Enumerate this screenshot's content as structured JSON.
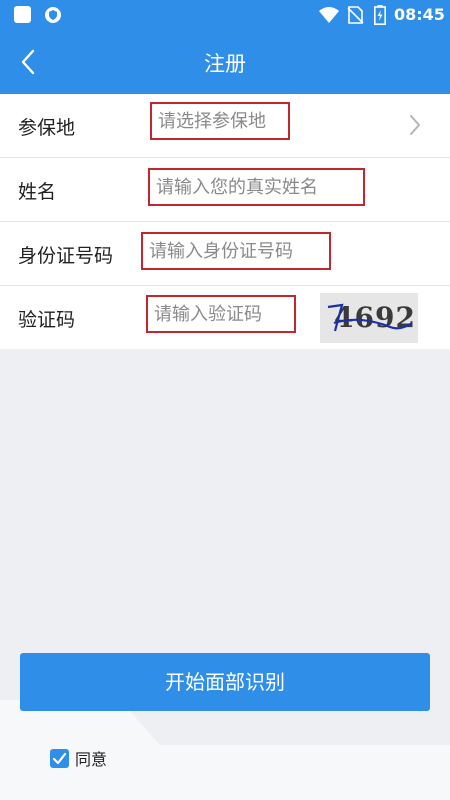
{
  "status_bar": {
    "time": "08:45",
    "icons": [
      "app-icon",
      "shield-app-icon",
      "wifi-icon",
      "no-sim-icon",
      "battery-charging-icon"
    ]
  },
  "header": {
    "title": "注册",
    "back_icon": "chevron-left-icon"
  },
  "form": {
    "rows": [
      {
        "label": "参保地",
        "placeholder": "请选择参保地",
        "value": "",
        "trailing_icon": "chevron-right-icon"
      },
      {
        "label": "姓名",
        "placeholder": "请输入您的真实姓名",
        "value": ""
      },
      {
        "label": "身份证号码",
        "placeholder": "请输入身份证号码",
        "value": ""
      },
      {
        "label": "验证码",
        "placeholder": "请输入验证码",
        "value": ""
      }
    ],
    "captcha_text": "4692"
  },
  "actions": {
    "submit_label": "开始面部识别"
  },
  "agreement": {
    "label": "同意",
    "checked": true
  },
  "colors": {
    "primary": "#2f8ee8",
    "background": "#eeeff3",
    "highlight_border": "#c2262e",
    "placeholder": "#8a8a8a"
  }
}
